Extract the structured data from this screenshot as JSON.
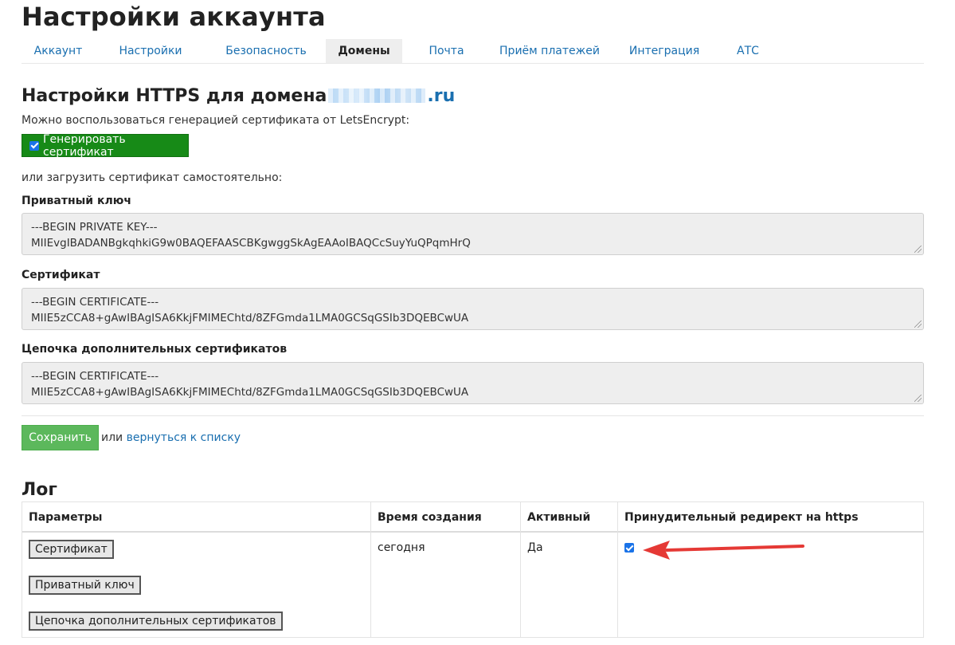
{
  "page_title": "Настройки аккаунта",
  "tabs": [
    {
      "label": "Аккаунт",
      "active": false
    },
    {
      "label": "Настройки",
      "active": false
    },
    {
      "label": "Безопасность",
      "active": false
    },
    {
      "label": "Домены",
      "active": true
    },
    {
      "label": "Почта",
      "active": false
    },
    {
      "label": "Приём платежей",
      "active": false
    },
    {
      "label": "Интеграция",
      "active": false
    },
    {
      "label": "АТС",
      "active": false
    }
  ],
  "https": {
    "heading": "Настройки HTTPS для домена",
    "domain_tld": ".ru",
    "letsencrypt_note": "Можно воспользоваться генерацией сертификата от LetsEncrypt:",
    "generate_button": "Генерировать сертификат",
    "generate_checked": true,
    "manual_note": "или загрузить сертификат самостоятельно:",
    "private_key": {
      "label": "Приватный ключ",
      "line1": "---BEGIN PRIVATE KEY---",
      "line2": "MIIEvgIBADANBgkqhkiG9w0BAQEFAASCBKgwggSkAgEAAoIBAQCcSuyYuQPqmHrQ"
    },
    "certificate": {
      "label": "Сертификат",
      "line1": "---BEGIN CERTIFICATE---",
      "line2": "MIIE5zCCA8+gAwIBAgISA6KkjFMIMEChtd/8ZFGmda1LMA0GCSqGSIb3DQEBCwUA"
    },
    "chain": {
      "label": "Цепочка дополнительных сертификатов",
      "line1": "---BEGIN CERTIFICATE---",
      "line2": "MIIE5zCCA8+gAwIBAgISA6KkjFMIMEChtd/8ZFGmda1LMA0GCSqGSIb3DQEBCwUA"
    },
    "save_button": "Сохранить",
    "or_text": "или",
    "back_link": "вернуться к списку"
  },
  "log": {
    "title": "Лог",
    "headers": {
      "params": "Параметры",
      "created": "Время создания",
      "active": "Активный",
      "redirect": "Принудительный редирект на https"
    },
    "row": {
      "buttons": {
        "certificate": "Сертификат",
        "private_key": "Приватный ключ",
        "chain": "Цепочка дополнительных сертификатов"
      },
      "created": "сегодня",
      "active": "Да",
      "redirect_checked": true
    }
  },
  "colors": {
    "link": "#1a6fb0",
    "generate_button": "#178a17",
    "save_button": "#5cb85c",
    "checkbox": "#1a73e8",
    "annotation_arrow": "#e53935"
  }
}
